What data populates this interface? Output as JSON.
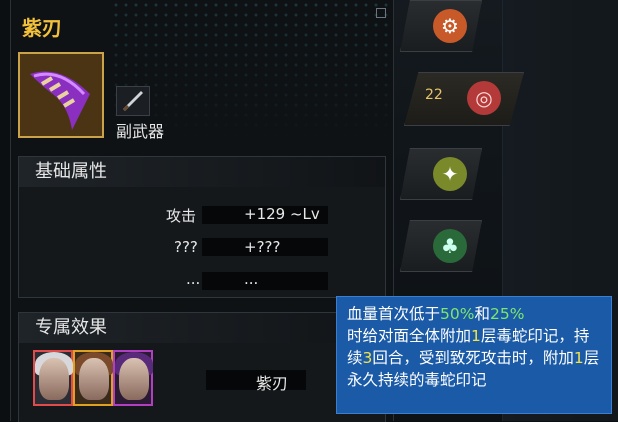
{
  "item": {
    "name": "紫刃",
    "sub_type_label": "副武器",
    "icon": "purple-blade-weapon-icon"
  },
  "base_stats": {
    "title": "基础属性",
    "rows": [
      {
        "label": "攻击",
        "value": "+129 ~Lv"
      },
      {
        "label": "???",
        "value": "+???"
      },
      {
        "label": "...",
        "value": "..."
      }
    ]
  },
  "exclusive": {
    "title": "专属效果",
    "heroes": [
      {
        "name": "hero-portrait-1",
        "border": "#e24b4b"
      },
      {
        "name": "hero-portrait-2",
        "border": "#e0a020"
      },
      {
        "name": "hero-portrait-3",
        "border": "#b040c0"
      }
    ],
    "effect_name": "紫刃"
  },
  "side_slots": [
    {
      "icon": "link-icon"
    },
    {
      "icon": "target-icon",
      "level": "22"
    },
    {
      "icon": "ammo-icon"
    },
    {
      "icon": "tree-icon"
    }
  ],
  "tooltip": {
    "t1": "血量首次低于",
    "p1": "50%",
    "t2": "和",
    "p2": "25%",
    "t3": "时给对面全体附加",
    "n1": "1",
    "t4": "层毒蛇印记，持续",
    "n2": "3",
    "t5": "回合，受到致死攻击时，附加",
    "n3": "1",
    "t6": "层永久持续的毒蛇印记"
  },
  "colors": {
    "accent_gold": "#f3c23a",
    "tooltip_blue": "#1a5aa6",
    "highlight_green": "#7de86c"
  }
}
